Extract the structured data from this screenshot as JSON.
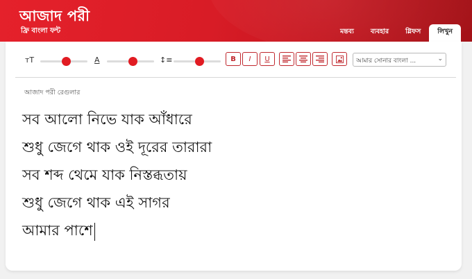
{
  "app": {
    "title": "আজাদ পরী",
    "subtitle": "ফ্রি বাংলা ফন্ট"
  },
  "tabs": [
    {
      "label": "মন্তব্য",
      "active": false
    },
    {
      "label": "ব্যবহার",
      "active": false
    },
    {
      "label": "গ্লিফস",
      "active": false
    },
    {
      "label": "লিখুন",
      "active": true
    }
  ],
  "toolbar": {
    "size_icon": "ᴛT",
    "color_icon": "A",
    "spacing_icon": "↕≡",
    "sliders": {
      "size": 0.55,
      "color": 0.55,
      "spacing": 0.55
    },
    "bold_label": "B",
    "italic_label": "I",
    "underline_label": "U",
    "sample_select": {
      "value": "আমার সোনার বাংলা ..."
    }
  },
  "editor": {
    "font_name": "আজাদ পরী রেগুলার",
    "lines": [
      "সব আলো নিভে যাক আঁধারে",
      "শুধু জেগে থাক ওই দূরের তারারা",
      "সব শব্দ থেমে যাক নিস্তব্ধতায়",
      "শুধু জেগে থাক এই সাগর",
      "আমার পাশে"
    ]
  },
  "colors": {
    "brand": "#e11b22",
    "accent_border": "#c0272d"
  }
}
